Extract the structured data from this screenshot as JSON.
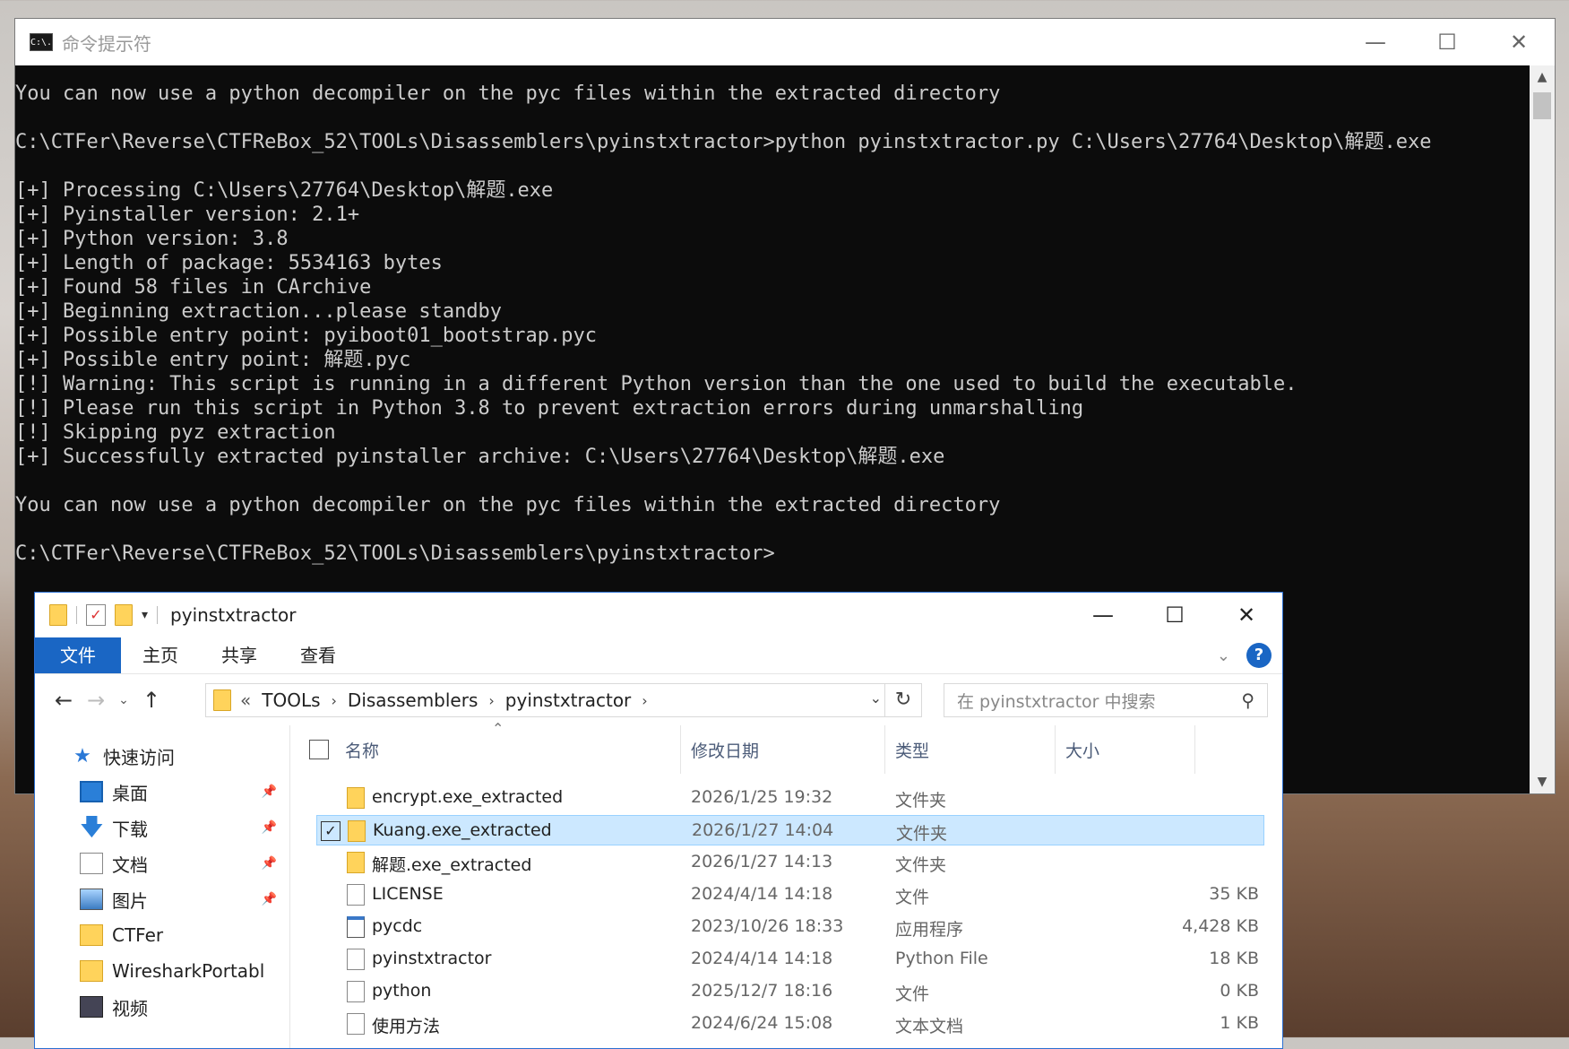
{
  "cmd": {
    "title": "命令提示符",
    "icon_text": "C:\\.",
    "lines": [
      "You can now use a python decompiler on the pyc files within the extracted directory",
      "",
      "C:\\CTFer\\Reverse\\CTFReBox_52\\TOOLs\\Disassemblers\\pyinstxtractor>python pyinstxtractor.py C:\\Users\\27764\\Desktop\\解题.exe",
      "",
      "[+] Processing C:\\Users\\27764\\Desktop\\解题.exe",
      "[+] Pyinstaller version: 2.1+",
      "[+] Python version: 3.8",
      "[+] Length of package: 5534163 bytes",
      "[+] Found 58 files in CArchive",
      "[+] Beginning extraction...please standby",
      "[+] Possible entry point: pyiboot01_bootstrap.pyc",
      "[+] Possible entry point: 解题.pyc",
      "[!] Warning: This script is running in a different Python version than the one used to build the executable.",
      "[!] Please run this script in Python 3.8 to prevent extraction errors during unmarshalling",
      "[!] Skipping pyz extraction",
      "[+] Successfully extracted pyinstaller archive: C:\\Users\\27764\\Desktop\\解题.exe",
      "",
      "You can now use a python decompiler on the pyc files within the extracted directory",
      "",
      "C:\\CTFer\\Reverse\\CTFReBox_52\\TOOLs\\Disassemblers\\pyinstxtractor>"
    ]
  },
  "explorer": {
    "title": "pyinstxtractor",
    "ribbon_tabs": [
      "文件",
      "主页",
      "共享",
      "查看"
    ],
    "breadcrumb": [
      "TOOLs",
      "Disassemblers",
      "pyinstxtractor"
    ],
    "breadcrumb_prefix": "«",
    "search_placeholder": "在 pyinstxtractor 中搜索",
    "nav": {
      "quick_access": "快速访问",
      "items": [
        "桌面",
        "下载",
        "文档",
        "图片",
        "CTFer",
        "WiresharkPortabl",
        "视频"
      ]
    },
    "columns": {
      "name": "名称",
      "date": "修改日期",
      "type": "类型",
      "size": "大小"
    },
    "files": [
      {
        "name": "encrypt.exe_extracted",
        "date": "2026/1/25 19:32",
        "type": "文件夹",
        "size": "",
        "kind": "folder"
      },
      {
        "name": "Kuang.exe_extracted",
        "date": "2026/1/27 14:04",
        "type": "文件夹",
        "size": "",
        "kind": "folder",
        "selected": true
      },
      {
        "name": "解题.exe_extracted",
        "date": "2026/1/27 14:13",
        "type": "文件夹",
        "size": "",
        "kind": "folder"
      },
      {
        "name": "LICENSE",
        "date": "2024/4/14 14:18",
        "type": "文件",
        "size": "35 KB",
        "kind": "file"
      },
      {
        "name": "pycdc",
        "date": "2023/10/26 18:33",
        "type": "应用程序",
        "size": "4,428 KB",
        "kind": "app"
      },
      {
        "name": "pyinstxtractor",
        "date": "2024/4/14 14:18",
        "type": "Python File",
        "size": "18 KB",
        "kind": "py"
      },
      {
        "name": "python",
        "date": "2025/12/7 18:16",
        "type": "文件",
        "size": "0 KB",
        "kind": "file"
      },
      {
        "name": "使用方法",
        "date": "2024/6/24 15:08",
        "type": "文本文档",
        "size": "1 KB",
        "kind": "txt"
      }
    ]
  }
}
